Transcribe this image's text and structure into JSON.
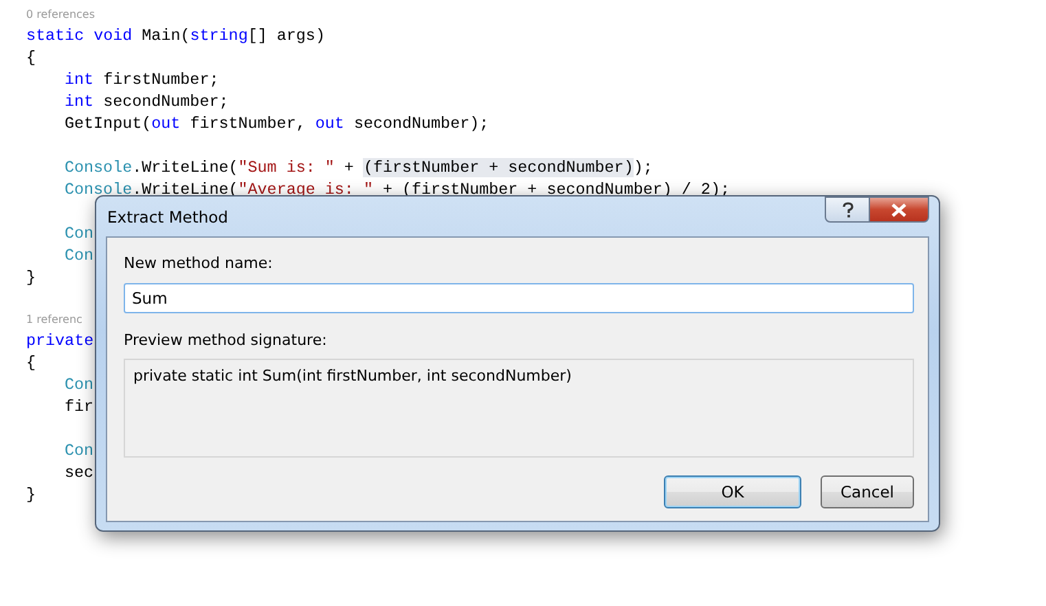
{
  "editor": {
    "methods": [
      {
        "references": "0 references",
        "signature": [
          {
            "kind": "keyword",
            "text": "static void "
          },
          {
            "kind": "plain",
            "text": "Main("
          },
          {
            "kind": "keyword",
            "text": "string"
          },
          {
            "kind": "plain",
            "text": "[] args)"
          }
        ],
        "open": "{",
        "blocks": [
          [
            [
              {
                "kind": "keyword",
                "text": "int "
              },
              {
                "kind": "plain",
                "text": "firstNumber;"
              }
            ],
            [
              {
                "kind": "keyword",
                "text": "int "
              },
              {
                "kind": "plain",
                "text": "secondNumber;"
              }
            ],
            [
              {
                "kind": "plain",
                "text": "GetInput("
              },
              {
                "kind": "keyword",
                "text": "out "
              },
              {
                "kind": "plain",
                "text": "firstNumber, "
              },
              {
                "kind": "keyword",
                "text": "out "
              },
              {
                "kind": "plain",
                "text": "secondNumber);"
              }
            ]
          ],
          [
            [
              {
                "kind": "type",
                "text": "Console"
              },
              {
                "kind": "plain",
                "text": ".WriteLine("
              },
              {
                "kind": "string",
                "text": "\"Sum is: \""
              },
              {
                "kind": "plain",
                "text": " + "
              },
              {
                "kind": "selection",
                "text": "(firstNumber + secondNumber)"
              },
              {
                "kind": "plain",
                "text": ");"
              }
            ],
            [
              {
                "kind": "type",
                "text": "Console"
              },
              {
                "kind": "plain",
                "text": ".WriteLine("
              },
              {
                "kind": "string",
                "text": "\"Average is: \""
              },
              {
                "kind": "plain",
                "text": " + (firstNumber + secondNumber) / 2);"
              }
            ]
          ],
          [
            [
              {
                "kind": "type",
                "text": "Con"
              }
            ],
            [
              {
                "kind": "type",
                "text": "Con"
              }
            ]
          ]
        ],
        "close": "}"
      },
      {
        "references": "1 referenc",
        "signature": [
          {
            "kind": "keyword",
            "text": "private"
          }
        ],
        "open": "{",
        "blocks": [
          [
            [
              {
                "kind": "type",
                "text": "Con"
              }
            ],
            [
              {
                "kind": "plain",
                "text": "fir"
              }
            ]
          ],
          [
            [
              {
                "kind": "type",
                "text": "Con"
              }
            ],
            [
              {
                "kind": "plain",
                "text": "sec"
              }
            ]
          ]
        ],
        "close": "}"
      }
    ]
  },
  "dialog": {
    "title": "Extract Method",
    "name_label": "New method name:",
    "name_value": "Sum",
    "preview_label": "Preview method signature:",
    "preview": "private static int Sum(int firstNumber, int secondNumber)",
    "buttons": [
      {
        "label": "OK",
        "default": true
      },
      {
        "label": "Cancel",
        "default": false
      }
    ]
  }
}
